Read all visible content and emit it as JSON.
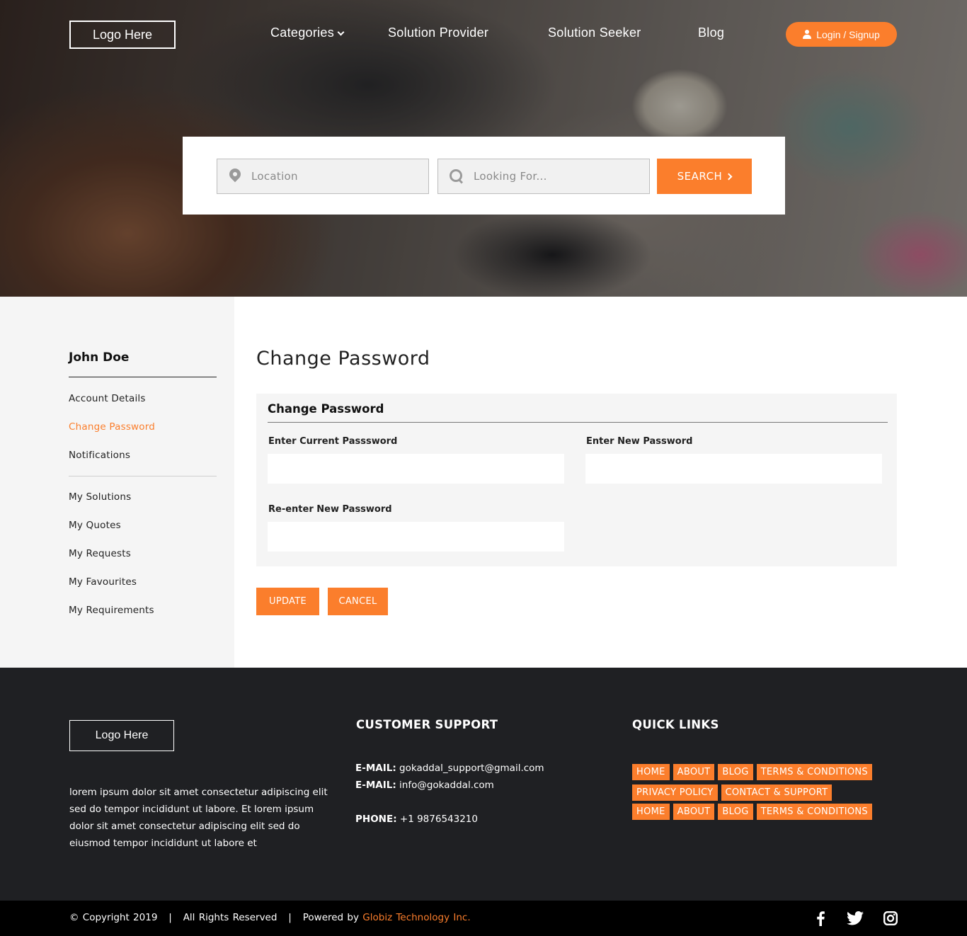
{
  "header": {
    "logo": "Logo Here",
    "nav": [
      {
        "label": "Categories"
      },
      {
        "label": "Solution Provider"
      },
      {
        "label": "Solution Seeker"
      },
      {
        "label": "Blog"
      }
    ],
    "login_label": "Login / Signup"
  },
  "search": {
    "location_placeholder": "Location",
    "looking_placeholder": "Looking For...",
    "button_label": "SEARCH"
  },
  "sidebar": {
    "user_name": "John Doe",
    "group1": [
      "Account Details",
      "Change Password",
      "Notifications"
    ],
    "group2": [
      "My Solutions",
      "My Quotes",
      "My Requests",
      "My Favourites",
      "My Requirements"
    ],
    "active": "Change Password"
  },
  "main": {
    "page_title": "Change Password",
    "card_title": "Change Password",
    "fields": {
      "current": "Enter Current Passsword",
      "new": "Enter New Password",
      "reenter": "Re-enter New Password"
    },
    "update_label": "UPDATE",
    "cancel_label": "CANCEL"
  },
  "footer": {
    "logo": "Logo Here",
    "about": "lorem ipsum dolor sit amet consectetur adipiscing elit sed do tempor incididunt ut labore.  Et lorem ipsum dolor sit amet consectetur adipiscing elit sed do eiusmod tempor incididunt ut labore et",
    "support_heading": "CUSTOMER SUPPORT",
    "email_label": "E-MAIL:",
    "email1": "gokaddal_support@gmail.com",
    "email2": "info@gokaddal.com",
    "phone_label": "PHONE:",
    "phone": "+1 9876543210",
    "links_heading": "QUICK LINKS",
    "links_row1": [
      "HOME",
      "ABOUT",
      "BLOG",
      "TERMS & CONDITIONS"
    ],
    "links_row2": [
      "PRIVACY POLICY",
      "CONTACT & SUPPORT"
    ],
    "links_row3": [
      "HOME",
      "ABOUT",
      "BLOG",
      "TERMS & CONDITIONS"
    ]
  },
  "bottom": {
    "copyright": "© Copyright 2019   |   All Rights Reserved   |   Powered by",
    "brand": "Globiz Technology Inc.",
    "social_icons": [
      "facebook-icon",
      "twitter-icon",
      "instagram-icon"
    ]
  },
  "colors": {
    "accent": "#fb7e2c",
    "footer_bg": "#1f2023",
    "sidebar_bg": "#f5f5f5"
  }
}
